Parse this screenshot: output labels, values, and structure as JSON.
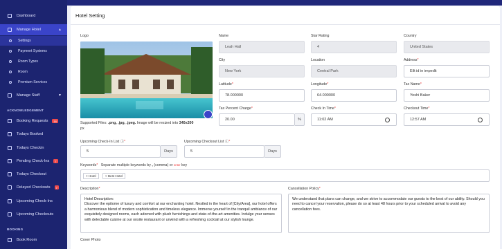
{
  "sidebar": {
    "items": {
      "dashboard": "Dashboard",
      "manage_hotel": "Manage Hotel",
      "manage_staff": "Manage Staff",
      "booking_requests": "Booking Requests",
      "todays_booked": "Todays Booked",
      "todays_checkin": "Todays Checkin",
      "pending_checkins": "Pending Check-Ins",
      "todays_checkout": "Todays Checkout",
      "delayed_checkouts": "Delayed Checkouts",
      "upcoming_checkins": "Upcoming Check-Ins",
      "upcoming_checkouts": "Upcoming Checkouts",
      "book_room": "Book Room"
    },
    "badges": {
      "booking_requests": "16",
      "pending_checkins": "7",
      "delayed_checkouts": "7"
    },
    "sub_items": [
      "Settings",
      "Payment Systems",
      "Room Types",
      "Room",
      "Premium Services"
    ],
    "sections": {
      "acknowledgement": "ACKNOWLEDGEMENT",
      "booking": "BOOKING"
    }
  },
  "page": {
    "title": "Hotel Setting"
  },
  "form": {
    "logo_label": "Logo",
    "supported_text": "Supported Files: ",
    "supported_types": ".png, .jpg, .jpeg.",
    "resize_text": " Image will be resized into ",
    "resize_size": "340x200",
    "resize_unit": "px",
    "name": {
      "label": "Name",
      "value": "Leah Hall"
    },
    "star_rating": {
      "label": "Star Rating",
      "value": "4"
    },
    "country": {
      "label": "Country",
      "value": "United States"
    },
    "city": {
      "label": "City",
      "value": "New York"
    },
    "location": {
      "label": "Location",
      "value": "Central Park"
    },
    "address": {
      "label": "Address",
      "value": "Eilt id in impedit"
    },
    "latitude": {
      "label": "Latitude",
      "value": "78.000000"
    },
    "longitude": {
      "label": "Longitude",
      "value": "64.000000"
    },
    "tax_name": {
      "label": "Tax Name",
      "value": "Yoshi Baker"
    },
    "tax_percent": {
      "label": "Tax Percent Charge",
      "value": "20.00",
      "suffix": "%"
    },
    "checkin_time": {
      "label": "Check In Time",
      "value": "11:02 AM"
    },
    "checkout_time": {
      "label": "Checkout Time",
      "value": "12:57 AM"
    },
    "upcoming_checkin": {
      "label": "Upcoming Check-In List",
      "value": "5",
      "suffix": "Days"
    },
    "upcoming_checkout": {
      "label": "Upcoming Checkout List",
      "value": "5",
      "suffix": "Days"
    },
    "keywords": {
      "label": "Keywords",
      "hint_before": "Separate multiple keywords by",
      "hint_comma": ",",
      "hint_middle": "(comma) or",
      "hint_enter": "enter",
      "hint_after": "key",
      "chips": [
        "Hotel",
        "Best Hotel"
      ]
    },
    "description": {
      "label": "Description",
      "value": "Hotel Description:\nDiscover the epitome of luxury and comfort at our enchanting hotel. Nestled in the heart of [City/Area], our hotel offers a harmonious blend of modern sophistication and timeless elegance. Immerse yourself in the tranquil ambiance of our exquisitely designed rooms, each adorned with plush furnishings and state-of-the-art amenities. Indulge your senses with delectable cuisine at our onsite restaurant or unwind with a refreshing cocktail at our stylish lounge."
    },
    "cancellation": {
      "label": "Cancellation Policy",
      "value": "We understand that plans can change, and we strive to accommodate our guests to the best of our ability. Should you need to cancel your reservation, please do so at least 48 hours prior to your scheduled arrival to avoid any cancellation fees."
    },
    "cover_photo_label": "Cover Photo"
  },
  "colors": {
    "sidebar": "#1c2470",
    "active": "#3a44c9",
    "required": "#e33333"
  }
}
